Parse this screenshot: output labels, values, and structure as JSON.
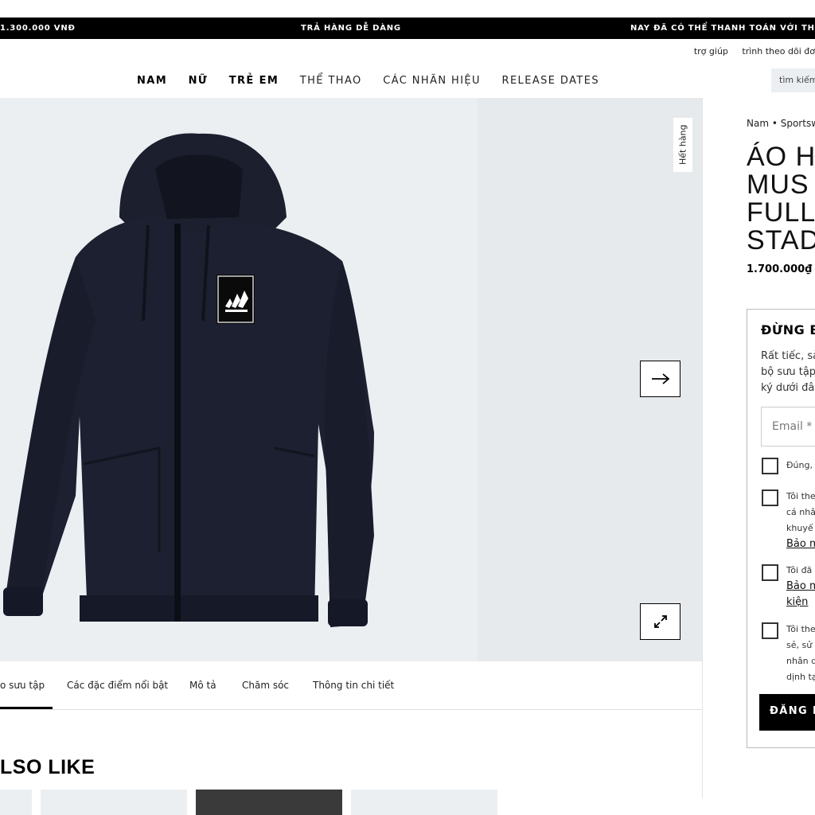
{
  "promo_bar": {
    "left": "1.300.000 VNĐ",
    "middle": "TRẢ HÀNG DỄ DÀNG",
    "right": "NAY ĐÃ CÓ THỂ THANH TOÁN VỚI TH"
  },
  "utility_links": [
    "trợ giúp",
    "trình theo dõi đơ"
  ],
  "nav": {
    "items": [
      "NAM",
      "NỮ",
      "TRẺ EM",
      "THỂ THAO",
      "CÁC NHÃN HIỆU",
      "RELEASE DATES"
    ]
  },
  "search": {
    "placeholder": "tìm kiếm"
  },
  "gallery": {
    "badge": "Hết hàng",
    "next_icon": "arrow-right-icon",
    "zoom_icon": "expand-icon"
  },
  "tabs": [
    "o sưu tập",
    "Các đặc điểm nổi bật",
    "Mô tả",
    "Chăm sóc",
    "Thông tin chi tiết"
  ],
  "also_like": {
    "heading": "LSO LIKE"
  },
  "product": {
    "breadcrumb": "Nam • Sportsw",
    "title": "ÁO H\nMUS\nFULL\nSTAD",
    "price": "1.700.000₫"
  },
  "signup": {
    "heading": "ĐỪNG B",
    "text": "Rất tiếc, sả\nbộ sưu tập\nký dưới đâ",
    "email_placeholder": "Email *",
    "checkbox_1": "Đúng,",
    "checkbox_2": "Tôi the\ncá nhâ\nkhuyế",
    "checkbox_2_link": "Bảo m",
    "checkbox_3": "Tôi đã",
    "checkbox_3_link_1": "Bảo m",
    "checkbox_3_link_2": "kiện",
    "checkbox_4": "Tôi the\nsẻ, sử\nnhân d\ndịnh tạ",
    "button_label": "ĐĂNG K"
  }
}
